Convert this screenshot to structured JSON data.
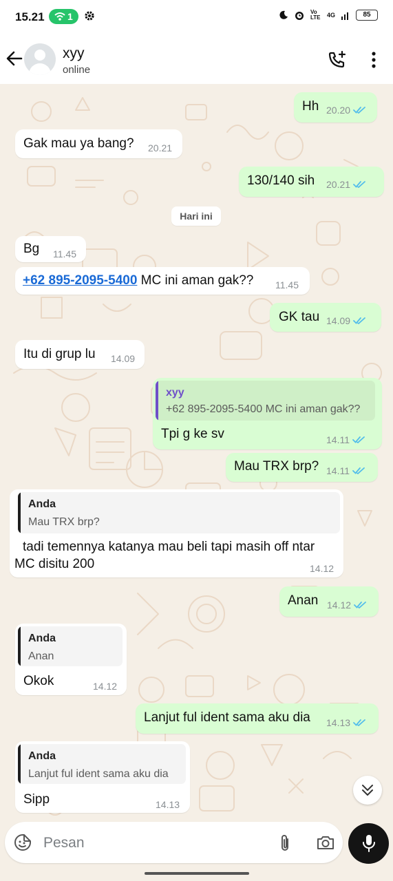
{
  "status_bar": {
    "time": "15.21",
    "hotspot_count": "1",
    "network_text": "4G",
    "volte_text": "Vo LTE",
    "battery": "85",
    "icons": [
      "hotspot-icon",
      "gear-icon",
      "moon-icon",
      "alarm-icon",
      "signal-icon",
      "battery-icon"
    ]
  },
  "header": {
    "contact_name": "xyy",
    "contact_status": "online",
    "icons": [
      "back-arrow-icon",
      "avatar-placeholder",
      "add-call-icon",
      "more-vert-icon"
    ]
  },
  "date_separator": "Hari ini",
  "messages": [
    {
      "dir": "out",
      "text": "Hh",
      "time": "20.20",
      "read": true
    },
    {
      "dir": "in",
      "text": "Gak mau ya bang?",
      "time": "20.21"
    },
    {
      "dir": "out",
      "text": "130/140 sih",
      "time": "20.21",
      "read": true
    },
    {
      "dir": "in",
      "text": "Bg",
      "time": "11.45"
    },
    {
      "dir": "in",
      "link": "+62 895-2095-5400",
      "text": " MC ini aman gak??",
      "time": "11.45"
    },
    {
      "dir": "out",
      "text": "GK tau",
      "time": "14.09",
      "read": true
    },
    {
      "dir": "in",
      "text": "Itu di grup lu",
      "time": "14.09"
    },
    {
      "dir": "out",
      "quote_name": "xyy",
      "quote_text": "+62 895-2095-5400 MC ini aman gak??",
      "text": "Tpi g ke sv",
      "time": "14.11",
      "read": true
    },
    {
      "dir": "out",
      "text": "Mau TRX brp?",
      "time": "14.11",
      "read": true
    },
    {
      "dir": "in",
      "quote_name": "Anda",
      "quote_text": "Mau TRX brp?",
      "text_line1": "tadi temennya katanya mau beli tapi masih off ntar",
      "text_line2": "MC disitu 200",
      "time": "14.12"
    },
    {
      "dir": "out",
      "text": "Anan",
      "time": "14.12",
      "read": true
    },
    {
      "dir": "in",
      "quote_name": "Anda",
      "quote_text": "Anan",
      "text": "Okok",
      "time": "14.12"
    },
    {
      "dir": "out",
      "text": "Lanjut ful ident sama aku dia",
      "time": "14.13",
      "read": true
    },
    {
      "dir": "in",
      "quote_name": "Anda",
      "quote_text": "Lanjut ful ident sama aku dia",
      "text": "Sipp",
      "time": "14.13"
    }
  ],
  "composer": {
    "placeholder": "Pesan",
    "icons": [
      "emoji-sticker-icon",
      "paperclip-icon",
      "camera-icon",
      "mic-icon",
      "chevron-double-down-icon"
    ]
  },
  "colors": {
    "chat_bg": "#f5efe6",
    "outgoing_bubble": "#d9fdd3",
    "incoming_bubble": "#ffffff",
    "read_tick": "#53bdeb",
    "link": "#1a6ad6",
    "hotspot_green": "#26c46a",
    "quote_bar_contact": "#6f4fc9",
    "quote_bar_self": "#1f1f1f"
  }
}
